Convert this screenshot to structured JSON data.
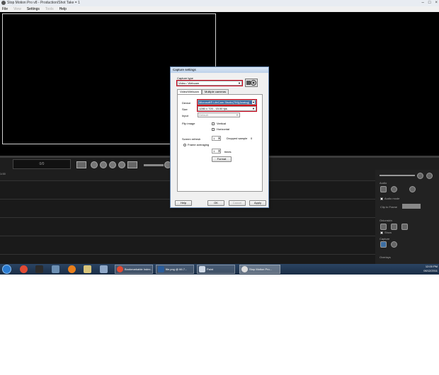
{
  "window": {
    "title": "Stop Motion Pro v8 - Production/Shot Take = 1",
    "controls": [
      "–",
      "□",
      "×"
    ]
  },
  "menu": {
    "items": [
      {
        "label": "File",
        "enabled": true
      },
      {
        "label": "View",
        "enabled": false
      },
      {
        "label": "Settings",
        "enabled": true
      },
      {
        "label": "Tools",
        "enabled": false
      },
      {
        "label": "Help",
        "enabled": true
      }
    ]
  },
  "transport": {
    "timecode": "0/0",
    "track_label": "1:00"
  },
  "sidepanel": {
    "sections": [
      "Audio",
      "Audio mode",
      "Clip to Frame",
      "Onionskin",
      "Show",
      "Capture",
      "Overlays"
    ],
    "mode_label": "Overlays"
  },
  "dialog": {
    "title": "Capture settings",
    "capture_type_label": "Capture type",
    "capture_type_value": "Video / Webcam",
    "tabs": [
      "Video/Webcam",
      "Multiple cameras"
    ],
    "device_label": "Device",
    "device_value": "Microsoft® LifeCam Studio(TM)(Analog)",
    "size_label": "Size",
    "size_value": "1280 x 720 - 15.00 fps",
    "input_label": "Input",
    "input_value": "Default",
    "flip_label": "Flip image",
    "flip_vertical": "Vertical",
    "flip_horizontal": "Horizontal",
    "screen_refresh_label": "Screen refresh",
    "screen_refresh_value": "1",
    "dropped_label": "Dropped sample",
    "dropped_value": "0",
    "frame_avg_label": "Frame averaging",
    "frame_avg_value": "1",
    "times_label": "times",
    "format_button": "Format",
    "help_button": "Help",
    "ok_button": "OK",
    "cancel_button": "Cancel",
    "apply_button": "Apply",
    "highlight_color": "#d0021b"
  },
  "taskbar": {
    "tasks": [
      {
        "label": "Bookmarkable Index..."
      },
      {
        "label": "file.png @ 66.7..."
      },
      {
        "label": "Paint"
      },
      {
        "label": "Stop Motion Pro..."
      }
    ],
    "time": "12:00 PM",
    "date": "06/12/2011"
  }
}
